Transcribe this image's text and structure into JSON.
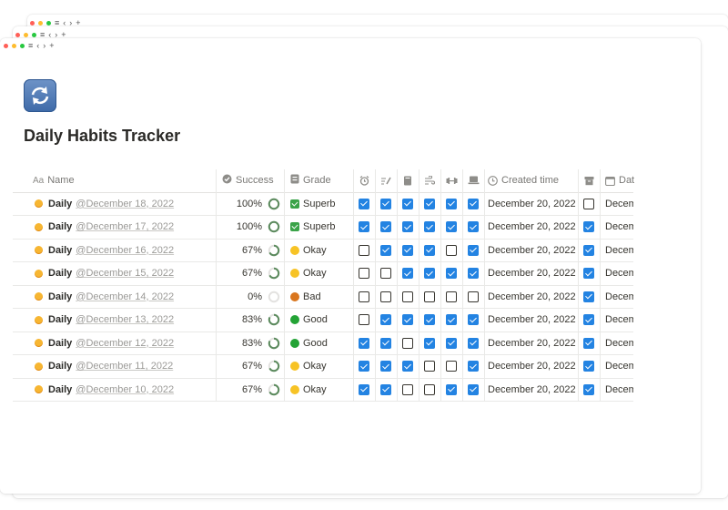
{
  "page": {
    "title": "Daily Habits Tracker",
    "icon": "sync-arrows-icon"
  },
  "window_controls": {
    "menu": "≡",
    "back": "‹",
    "forward": "›",
    "new_tab": "+"
  },
  "table": {
    "headers": {
      "name": "Name",
      "success": "Success",
      "grade": "Grade",
      "created_time": "Created time",
      "date": "Dat"
    },
    "habit_icons": [
      "alarm-icon",
      "writing-icon",
      "book-icon",
      "wind-icon",
      "dumbbell-icon",
      "laptop-icon"
    ],
    "rows": [
      {
        "name": "Daily",
        "date": "@December 18, 2022",
        "success": "100%",
        "fraction": 1.0,
        "grade": "Superb",
        "grade_icon": "check-box-emoji-icon",
        "habits": [
          true,
          true,
          true,
          true,
          true,
          true
        ],
        "created": "December 20, 2022",
        "done": false,
        "date_col": "Decem"
      },
      {
        "name": "Daily",
        "date": "@December 17, 2022",
        "success": "100%",
        "fraction": 1.0,
        "grade": "Superb",
        "grade_icon": "check-box-emoji-icon",
        "habits": [
          true,
          true,
          true,
          true,
          true,
          true
        ],
        "created": "December 20, 2022",
        "done": true,
        "date_col": "Decem"
      },
      {
        "name": "Daily",
        "date": "@December 16, 2022",
        "success": "67%",
        "fraction": 0.67,
        "grade": "Okay",
        "grade_icon": "yellow-circle-icon",
        "habits": [
          false,
          true,
          true,
          true,
          false,
          true
        ],
        "created": "December 20, 2022",
        "done": true,
        "date_col": "Decem"
      },
      {
        "name": "Daily",
        "date": "@December 15, 2022",
        "success": "67%",
        "fraction": 0.67,
        "grade": "Okay",
        "grade_icon": "yellow-circle-icon",
        "habits": [
          false,
          false,
          true,
          true,
          true,
          true
        ],
        "created": "December 20, 2022",
        "done": true,
        "date_col": "Decem"
      },
      {
        "name": "Daily",
        "date": "@December 14, 2022",
        "success": "0%",
        "fraction": 0.0,
        "grade": "Bad",
        "grade_icon": "angry-face-icon",
        "habits": [
          false,
          false,
          false,
          false,
          false,
          false
        ],
        "created": "December 20, 2022",
        "done": true,
        "date_col": "Decem"
      },
      {
        "name": "Daily",
        "date": "@December 13, 2022",
        "success": "83%",
        "fraction": 0.83,
        "grade": "Good",
        "grade_icon": "green-circle-icon",
        "habits": [
          false,
          true,
          true,
          true,
          true,
          true
        ],
        "created": "December 20, 2022",
        "done": true,
        "date_col": "Decem"
      },
      {
        "name": "Daily",
        "date": "@December 12, 2022",
        "success": "83%",
        "fraction": 0.83,
        "grade": "Good",
        "grade_icon": "green-circle-icon",
        "habits": [
          true,
          true,
          false,
          true,
          true,
          true
        ],
        "created": "December 20, 2022",
        "done": true,
        "date_col": "Decem"
      },
      {
        "name": "Daily",
        "date": "@December 11, 2022",
        "success": "67%",
        "fraction": 0.67,
        "grade": "Okay",
        "grade_icon": "yellow-circle-icon",
        "habits": [
          true,
          true,
          true,
          false,
          false,
          true
        ],
        "created": "December 20, 2022",
        "done": true,
        "date_col": "Decem"
      },
      {
        "name": "Daily",
        "date": "@December 10, 2022",
        "success": "67%",
        "fraction": 0.67,
        "grade": "Okay",
        "grade_icon": "yellow-circle-icon",
        "habits": [
          true,
          true,
          false,
          false,
          true,
          true
        ],
        "created": "December 20, 2022",
        "done": true,
        "date_col": "Decem"
      }
    ]
  },
  "colors": {
    "checkbox_on": "#2383e2",
    "ring": "#5b8a5d",
    "ring_track": "#e3e2e0"
  }
}
